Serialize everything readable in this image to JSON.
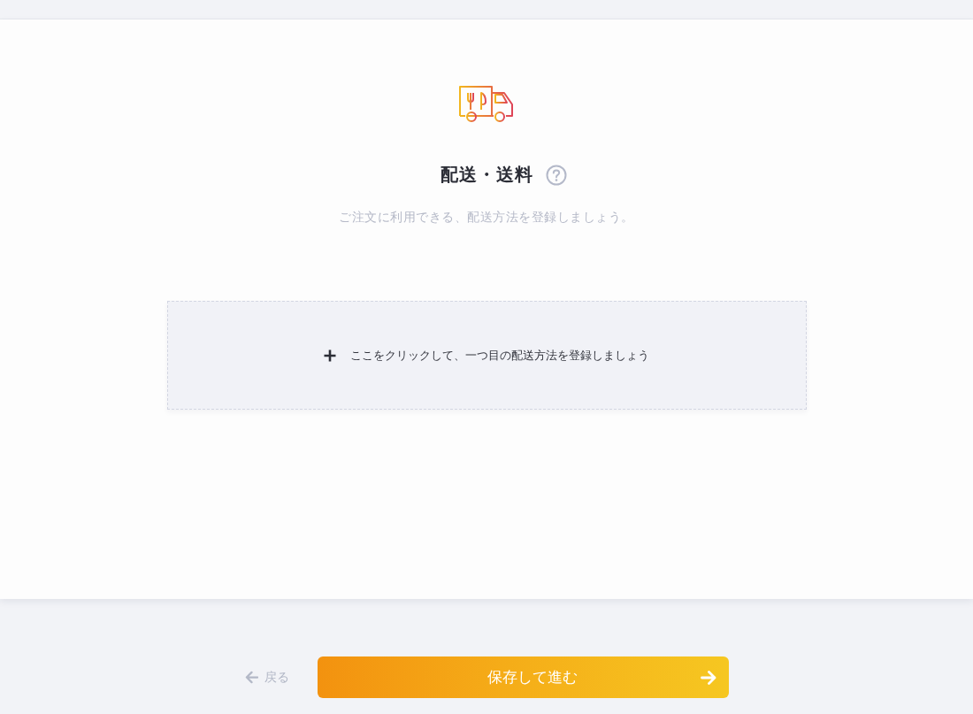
{
  "header": {
    "title": "配送・送料",
    "subtitle": "ご注文に利用できる、配送方法を登録しましょう。"
  },
  "add_method": {
    "label": "ここをクリックして、一つ目の配送方法を登録しましょう"
  },
  "footer": {
    "back": "戻る",
    "submit": "保存して進む"
  }
}
